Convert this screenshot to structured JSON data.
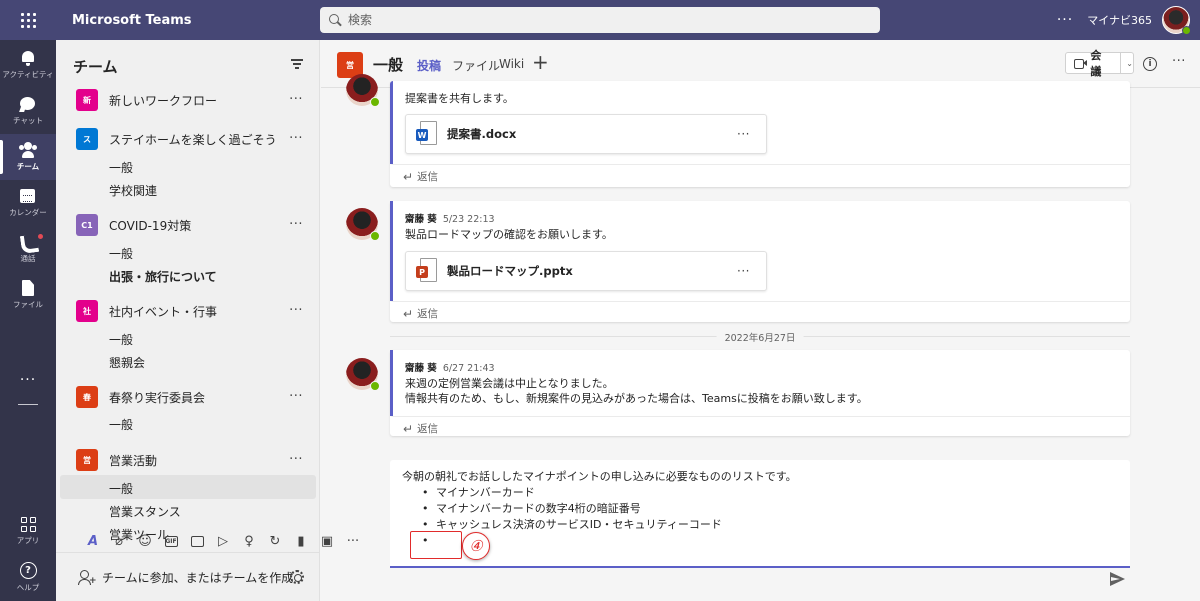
{
  "app": {
    "name": "Microsoft Teams",
    "search_placeholder": "検索",
    "more": "···",
    "tenant": "マイナビ365"
  },
  "rail": {
    "items": [
      {
        "label": "アクティビティ",
        "icon": "bell-icon"
      },
      {
        "label": "チャット",
        "icon": "chat-icon"
      },
      {
        "label": "チーム",
        "icon": "teams-icon",
        "active": true
      },
      {
        "label": "カレンダー",
        "icon": "calendar-icon"
      },
      {
        "label": "通話",
        "icon": "phone-icon",
        "badge_color": "#e34a55"
      },
      {
        "label": "ファイル",
        "icon": "file-icon"
      }
    ],
    "more": "···",
    "apps_label": "アプリ",
    "help_label": "ヘルプ",
    "help_glyph": "?"
  },
  "teams_panel": {
    "title": "チーム",
    "teams": [
      {
        "name": "新しいワークフロー",
        "initials": "新",
        "color": "#e3008c",
        "more": "···"
      },
      {
        "name": "ステイホームを楽しく過ごそう",
        "initials": "ス",
        "color": "#0078d4",
        "more": "···",
        "channels": [
          "一般",
          "学校関連"
        ]
      },
      {
        "name": "COVID-19対策",
        "initials": "C1",
        "color": "#8764b8",
        "more": "···",
        "channels": [
          "一般",
          "出張・旅行について"
        ]
      },
      {
        "name": "社内イベント・行事",
        "initials": "社",
        "color": "#e3008c",
        "more": "···",
        "channels": [
          "一般",
          "懇親会"
        ]
      },
      {
        "name": "春祭り実行委員会",
        "initials": "春",
        "color": "#dc3e15",
        "more": "···",
        "channels": [
          "一般"
        ]
      },
      {
        "name": "営業活動",
        "initials": "営",
        "color": "#dc3e15",
        "more": "···",
        "channels": [
          "一般",
          "営業スタンス",
          "営業ツール"
        ]
      }
    ],
    "join_label": "チームに参加、またはチームを作成"
  },
  "channel_header": {
    "initials": "営",
    "title": "一般",
    "tabs": [
      "投稿",
      "ファイル",
      "Wiki"
    ],
    "active_tab": "投稿",
    "add_tab": "+",
    "meet_label": "会議",
    "meet_caret": "⌄",
    "info_glyph": "i",
    "more": "···"
  },
  "posts": [
    {
      "message": "提案書を共有します。",
      "attachment": {
        "name": "提案書.docx",
        "type": "word",
        "badge": "W",
        "badge_color": "#185abd",
        "more": "···"
      },
      "reply_label": "返信"
    },
    {
      "author": "齋藤 葵",
      "time": "5/23 22:13",
      "message": "製品ロードマップの確認をお願いします。",
      "attachment": {
        "name": "製品ロードマップ.pptx",
        "type": "powerpoint",
        "badge": "P",
        "badge_color": "#c43e1c",
        "more": "···"
      },
      "reply_label": "返信"
    },
    {
      "author": "齋藤 葵",
      "time": "6/27 21:43",
      "message_lines": [
        "来週の定例営業会議は中止となりました。",
        "情報共有のため、もし、新規案件の見込みがあった場合は、Teamsに投稿をお願い致します。"
      ],
      "reply_label": "返信"
    }
  ],
  "date_separator": "2022年6月27日",
  "compose": {
    "intro": "今朝の朝礼でお話ししたマイナポイントの申し込みに必要なもののリストです。",
    "bullets": [
      "マイナンバーカード",
      "マイナンバーカードの数字4桁の暗証番号",
      "キャッシュレス決済のサービスID・セキュリティーコード",
      ""
    ],
    "callout": "④",
    "accent_color": "#e12b2b"
  },
  "toolbar": {
    "icons": [
      "format-icon",
      "attach-icon",
      "emoji-icon",
      "gif-icon",
      "sticker-icon",
      "meet-now-icon",
      "praise-icon",
      "loop-icon",
      "forms-icon",
      "approvals-icon",
      "more-icon"
    ],
    "gif_text": "GIF",
    "more": "···"
  },
  "colors": {
    "topbar": "#464775",
    "rail": "#33344a",
    "accent": "#5b5fc7",
    "presence": "#6bb700"
  }
}
